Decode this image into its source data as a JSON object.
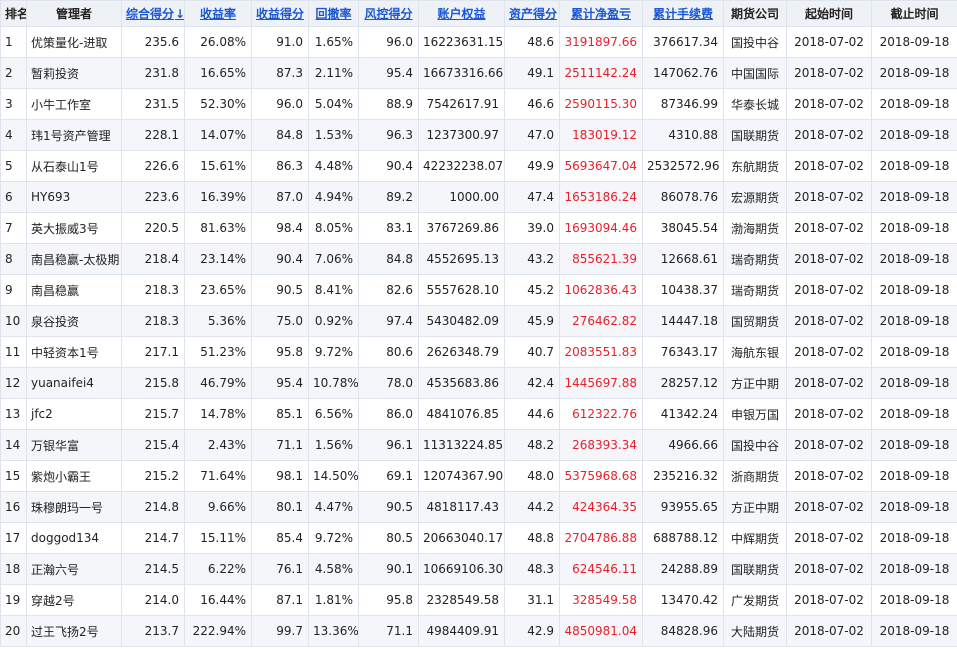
{
  "columns": [
    {
      "label": "排名",
      "sortable": false
    },
    {
      "label": "管理者",
      "sortable": false
    },
    {
      "label": "综合得分",
      "sortable": true,
      "sort_indicator": "↓"
    },
    {
      "label": "收益率",
      "sortable": true
    },
    {
      "label": "收益得分",
      "sortable": true
    },
    {
      "label": "回撤率",
      "sortable": true
    },
    {
      "label": "风控得分",
      "sortable": true
    },
    {
      "label": "账户权益",
      "sortable": true
    },
    {
      "label": "资产得分",
      "sortable": true
    },
    {
      "label": "累计净盈亏",
      "sortable": true
    },
    {
      "label": "累计手续费",
      "sortable": true
    },
    {
      "label": "期货公司",
      "sortable": false
    },
    {
      "label": "起始时间",
      "sortable": false
    },
    {
      "label": "截止时间",
      "sortable": false
    }
  ],
  "colors": {
    "header_bg": "#eef2f7",
    "link": "#1a56d6",
    "profit": "#e8202a",
    "row_alt": "#f4f6fa",
    "border": "#dde4ee"
  },
  "rows": [
    {
      "rank": "1",
      "manager": "优策量化-进取",
      "score": "235.6",
      "return_rate": "26.08%",
      "return_score": "91.0",
      "drawdown": "1.65%",
      "risk_score": "96.0",
      "equity": "16223631.15",
      "asset_score": "48.6",
      "net_pnl": "3191897.66",
      "fees": "376617.34",
      "broker": "国投中谷",
      "start": "2018-07-02",
      "end": "2018-09-18"
    },
    {
      "rank": "2",
      "manager": "暂莉投资",
      "score": "231.8",
      "return_rate": "16.65%",
      "return_score": "87.3",
      "drawdown": "2.11%",
      "risk_score": "95.4",
      "equity": "16673316.66",
      "asset_score": "49.1",
      "net_pnl": "2511142.24",
      "fees": "147062.76",
      "broker": "中国国际",
      "start": "2018-07-02",
      "end": "2018-09-18"
    },
    {
      "rank": "3",
      "manager": "小牛工作室",
      "score": "231.5",
      "return_rate": "52.30%",
      "return_score": "96.0",
      "drawdown": "5.04%",
      "risk_score": "88.9",
      "equity": "7542617.91",
      "asset_score": "46.6",
      "net_pnl": "2590115.30",
      "fees": "87346.99",
      "broker": "华泰长城",
      "start": "2018-07-02",
      "end": "2018-09-18"
    },
    {
      "rank": "4",
      "manager": "玮1号资产管理",
      "score": "228.1",
      "return_rate": "14.07%",
      "return_score": "84.8",
      "drawdown": "1.53%",
      "risk_score": "96.3",
      "equity": "1237300.97",
      "asset_score": "47.0",
      "net_pnl": "183019.12",
      "fees": "4310.88",
      "broker": "国联期货",
      "start": "2018-07-02",
      "end": "2018-09-18"
    },
    {
      "rank": "5",
      "manager": "从石泰山1号",
      "score": "226.6",
      "return_rate": "15.61%",
      "return_score": "86.3",
      "drawdown": "4.48%",
      "risk_score": "90.4",
      "equity": "42232238.07",
      "asset_score": "49.9",
      "net_pnl": "5693647.04",
      "fees": "2532572.96",
      "broker": "东航期货",
      "start": "2018-07-02",
      "end": "2018-09-18"
    },
    {
      "rank": "6",
      "manager": "HY693",
      "score": "223.6",
      "return_rate": "16.39%",
      "return_score": "87.0",
      "drawdown": "4.94%",
      "risk_score": "89.2",
      "equity": "1000.00",
      "asset_score": "47.4",
      "net_pnl": "1653186.24",
      "fees": "86078.76",
      "broker": "宏源期货",
      "start": "2018-07-02",
      "end": "2018-09-18"
    },
    {
      "rank": "7",
      "manager": "英大振威3号",
      "score": "220.5",
      "return_rate": "81.63%",
      "return_score": "98.4",
      "drawdown": "8.05%",
      "risk_score": "83.1",
      "equity": "3767269.86",
      "asset_score": "39.0",
      "net_pnl": "1693094.46",
      "fees": "38045.54",
      "broker": "渤海期货",
      "start": "2018-07-02",
      "end": "2018-09-18"
    },
    {
      "rank": "8",
      "manager": "南昌稳赢-太极期",
      "score": "218.4",
      "return_rate": "23.14%",
      "return_score": "90.4",
      "drawdown": "7.06%",
      "risk_score": "84.8",
      "equity": "4552695.13",
      "asset_score": "43.2",
      "net_pnl": "855621.39",
      "fees": "12668.61",
      "broker": "瑞奇期货",
      "start": "2018-07-02",
      "end": "2018-09-18"
    },
    {
      "rank": "9",
      "manager": "南昌稳赢",
      "score": "218.3",
      "return_rate": "23.65%",
      "return_score": "90.5",
      "drawdown": "8.41%",
      "risk_score": "82.6",
      "equity": "5557628.10",
      "asset_score": "45.2",
      "net_pnl": "1062836.43",
      "fees": "10438.37",
      "broker": "瑞奇期货",
      "start": "2018-07-02",
      "end": "2018-09-18"
    },
    {
      "rank": "10",
      "manager": "泉谷投资",
      "score": "218.3",
      "return_rate": "5.36%",
      "return_score": "75.0",
      "drawdown": "0.92%",
      "risk_score": "97.4",
      "equity": "5430482.09",
      "asset_score": "45.9",
      "net_pnl": "276462.82",
      "fees": "14447.18",
      "broker": "国贸期货",
      "start": "2018-07-02",
      "end": "2018-09-18"
    },
    {
      "rank": "11",
      "manager": "中轻资本1号",
      "score": "217.1",
      "return_rate": "51.23%",
      "return_score": "95.8",
      "drawdown": "9.72%",
      "risk_score": "80.6",
      "equity": "2626348.79",
      "asset_score": "40.7",
      "net_pnl": "2083551.83",
      "fees": "76343.17",
      "broker": "海航东银",
      "start": "2018-07-02",
      "end": "2018-09-18"
    },
    {
      "rank": "12",
      "manager": "yuanaifei4",
      "score": "215.8",
      "return_rate": "46.79%",
      "return_score": "95.4",
      "drawdown": "10.78%",
      "risk_score": "78.0",
      "equity": "4535683.86",
      "asset_score": "42.4",
      "net_pnl": "1445697.88",
      "fees": "28257.12",
      "broker": "方正中期",
      "start": "2018-07-02",
      "end": "2018-09-18"
    },
    {
      "rank": "13",
      "manager": "jfc2",
      "score": "215.7",
      "return_rate": "14.78%",
      "return_score": "85.1",
      "drawdown": "6.56%",
      "risk_score": "86.0",
      "equity": "4841076.85",
      "asset_score": "44.6",
      "net_pnl": "612322.76",
      "fees": "41342.24",
      "broker": "申银万国",
      "start": "2018-07-02",
      "end": "2018-09-18"
    },
    {
      "rank": "14",
      "manager": "万银华富",
      "score": "215.4",
      "return_rate": "2.43%",
      "return_score": "71.1",
      "drawdown": "1.56%",
      "risk_score": "96.1",
      "equity": "11313224.85",
      "asset_score": "48.2",
      "net_pnl": "268393.34",
      "fees": "4966.66",
      "broker": "国投中谷",
      "start": "2018-07-02",
      "end": "2018-09-18"
    },
    {
      "rank": "15",
      "manager": "紫炮小霸王",
      "score": "215.2",
      "return_rate": "71.64%",
      "return_score": "98.1",
      "drawdown": "14.50%",
      "risk_score": "69.1",
      "equity": "12074367.90",
      "asset_score": "48.0",
      "net_pnl": "5375968.68",
      "fees": "235216.32",
      "broker": "浙商期货",
      "start": "2018-07-02",
      "end": "2018-09-18"
    },
    {
      "rank": "16",
      "manager": "珠穆朗玛一号",
      "score": "214.8",
      "return_rate": "9.66%",
      "return_score": "80.1",
      "drawdown": "4.47%",
      "risk_score": "90.5",
      "equity": "4818117.43",
      "asset_score": "44.2",
      "net_pnl": "424364.35",
      "fees": "93955.65",
      "broker": "方正中期",
      "start": "2018-07-02",
      "end": "2018-09-18"
    },
    {
      "rank": "17",
      "manager": "doggod134",
      "score": "214.7",
      "return_rate": "15.11%",
      "return_score": "85.4",
      "drawdown": "9.72%",
      "risk_score": "80.5",
      "equity": "20663040.17",
      "asset_score": "48.8",
      "net_pnl": "2704786.88",
      "fees": "688788.12",
      "broker": "中辉期货",
      "start": "2018-07-02",
      "end": "2018-09-18"
    },
    {
      "rank": "18",
      "manager": "正瀚六号",
      "score": "214.5",
      "return_rate": "6.22%",
      "return_score": "76.1",
      "drawdown": "4.58%",
      "risk_score": "90.1",
      "equity": "10669106.30",
      "asset_score": "48.3",
      "net_pnl": "624546.11",
      "fees": "24288.89",
      "broker": "国联期货",
      "start": "2018-07-02",
      "end": "2018-09-18"
    },
    {
      "rank": "19",
      "manager": "穿越2号",
      "score": "214.0",
      "return_rate": "16.44%",
      "return_score": "87.1",
      "drawdown": "1.81%",
      "risk_score": "95.8",
      "equity": "2328549.58",
      "asset_score": "31.1",
      "net_pnl": "328549.58",
      "fees": "13470.42",
      "broker": "广发期货",
      "start": "2018-07-02",
      "end": "2018-09-18"
    },
    {
      "rank": "20",
      "manager": "过王飞扬2号",
      "score": "213.7",
      "return_rate": "222.94%",
      "return_score": "99.7",
      "drawdown": "13.36%",
      "risk_score": "71.1",
      "equity": "4984409.91",
      "asset_score": "42.9",
      "net_pnl": "4850981.04",
      "fees": "84828.96",
      "broker": "大陆期货",
      "start": "2018-07-02",
      "end": "2018-09-18"
    }
  ]
}
